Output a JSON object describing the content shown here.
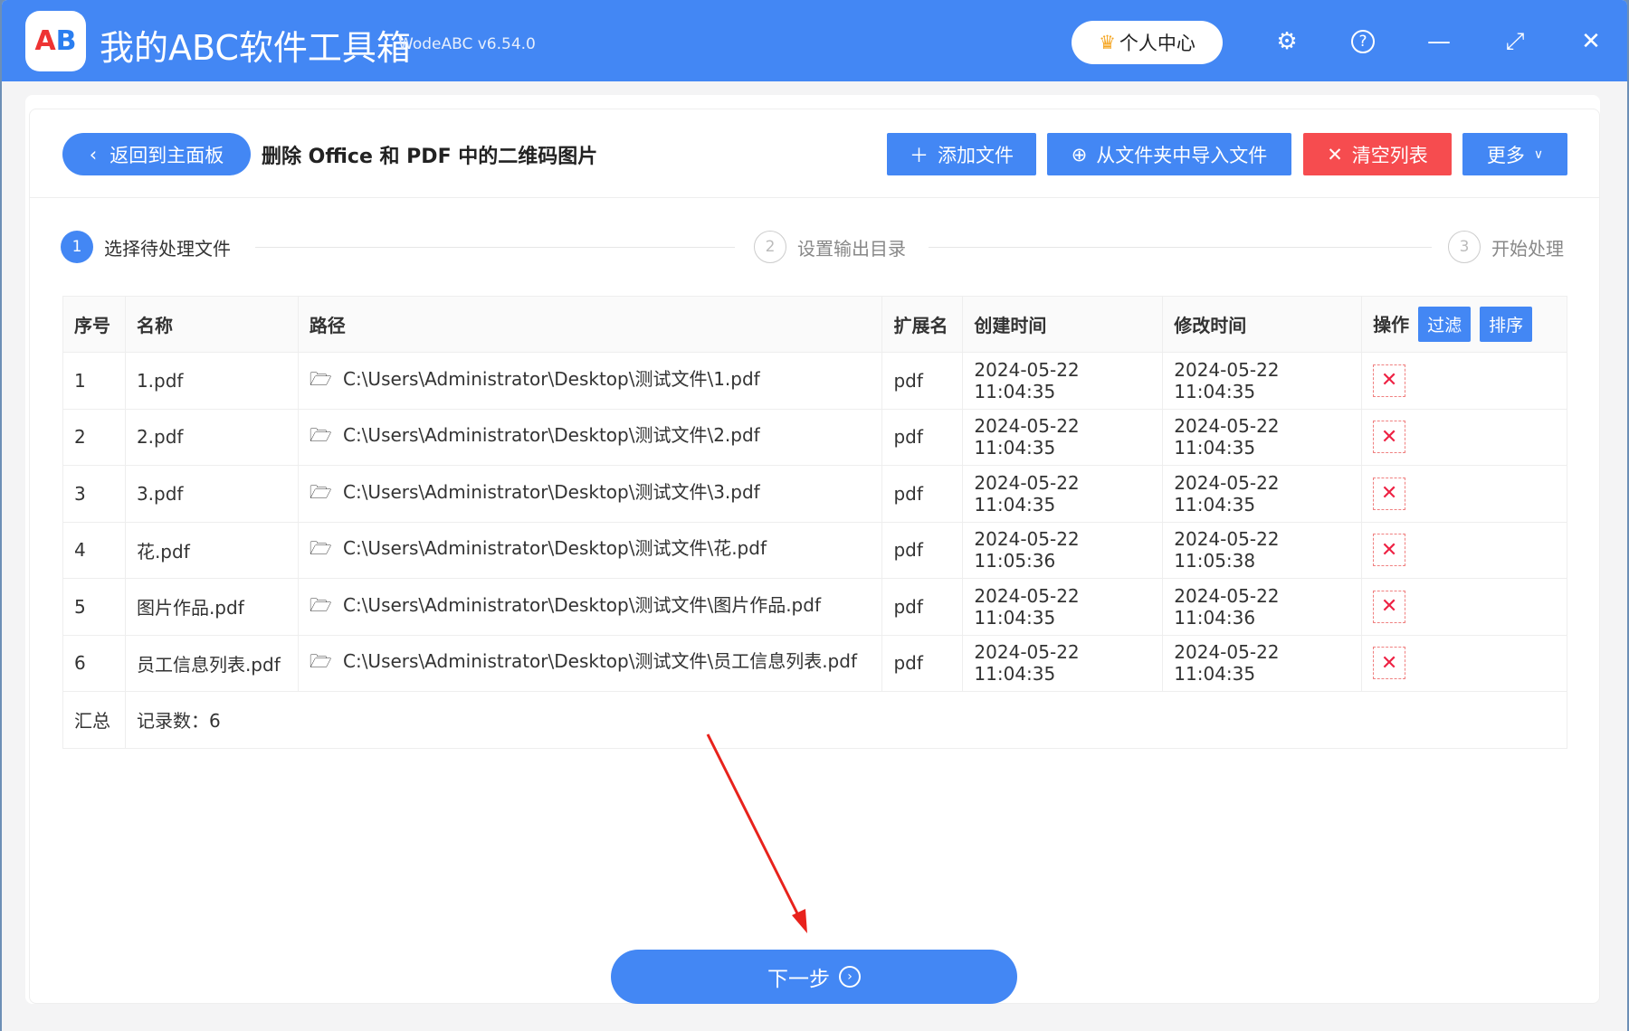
{
  "app": {
    "title": "我的ABC软件工具箱",
    "version": "WodeABC v6.54.0",
    "logo_text": "AB",
    "user_center": "个人中心"
  },
  "toolbar": {
    "back": "返回到主面板",
    "page_title": "删除 Office 和 PDF 中的二维码图片",
    "add_file": "添加文件",
    "import_folder": "从文件夹中导入文件",
    "clear_list": "清空列表",
    "more": "更多"
  },
  "steps": [
    {
      "num": "1",
      "label": "选择待处理文件"
    },
    {
      "num": "2",
      "label": "设置输出目录"
    },
    {
      "num": "3",
      "label": "开始处理"
    }
  ],
  "table": {
    "headers": [
      "序号",
      "名称",
      "路径",
      "扩展名",
      "创建时间",
      "修改时间",
      "操作"
    ],
    "filter": "过滤",
    "sort": "排序",
    "rows": [
      [
        "1",
        "1.pdf",
        "C:\\Users\\Administrator\\Desktop\\测试文件\\1.pdf",
        "pdf",
        "2024-05-22 11:04:35",
        "2024-05-22 11:04:35"
      ],
      [
        "2",
        "2.pdf",
        "C:\\Users\\Administrator\\Desktop\\测试文件\\2.pdf",
        "pdf",
        "2024-05-22 11:04:35",
        "2024-05-22 11:04:35"
      ],
      [
        "3",
        "3.pdf",
        "C:\\Users\\Administrator\\Desktop\\测试文件\\3.pdf",
        "pdf",
        "2024-05-22 11:04:35",
        "2024-05-22 11:04:35"
      ],
      [
        "4",
        "花.pdf",
        "C:\\Users\\Administrator\\Desktop\\测试文件\\花.pdf",
        "pdf",
        "2024-05-22 11:05:36",
        "2024-05-22 11:05:38"
      ],
      [
        "5",
        "图片作品.pdf",
        "C:\\Users\\Administrator\\Desktop\\测试文件\\图片作品.pdf",
        "pdf",
        "2024-05-22 11:04:35",
        "2024-05-22 11:04:36"
      ],
      [
        "6",
        "员工信息列表.pdf",
        "C:\\Users\\Administrator\\Desktop\\测试文件\\员工信息列表.pdf",
        "pdf",
        "2024-05-22 11:04:35",
        "2024-05-22 11:04:35"
      ]
    ],
    "summary_label": "汇总",
    "summary_value": "记录数：6"
  },
  "next": "下一步"
}
